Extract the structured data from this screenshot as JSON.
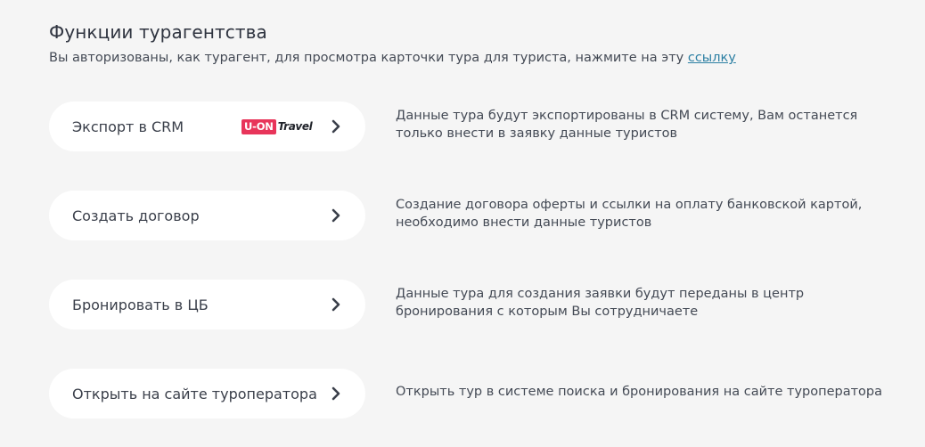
{
  "header": {
    "title": "Функции турагентства",
    "subtitle_text": "Вы авторизованы, как турагент, для просмотра карточки тура для туриста, нажмите на эту ",
    "subtitle_link": "ссылку"
  },
  "actions": [
    {
      "label": "Экспорт в CRM",
      "logo_box": "U-ON",
      "logo_text": "Travel",
      "description_line1": "Данные тура будут экспортированы в CRM систему, Вам останется",
      "description_line2": "только внести в заявку данные туристов"
    },
    {
      "label": "Создать договор",
      "description_line1": "Создание договора оферты и ссылки на оплату банковской картой,",
      "description_line2": "необходимо внести данные туристов"
    },
    {
      "label": "Бронировать в ЦБ",
      "description_line1": "Данные тура для создания заявки будут переданы в центр",
      "description_line2": "бронирования с которым Вы сотрудничаете"
    },
    {
      "label": "Открыть на сайте туроператора",
      "description_line1": "Открыть тур в системе поиска и бронирования на сайте туроператора"
    }
  ],
  "icons": {
    "chevron": "chevron-right-icon",
    "logo": "uon-travel-logo"
  },
  "colors": {
    "background": "#f5f5f5",
    "button_bg": "#ffffff",
    "link": "#2c7fa3",
    "uon_brand": "#e8355a"
  }
}
